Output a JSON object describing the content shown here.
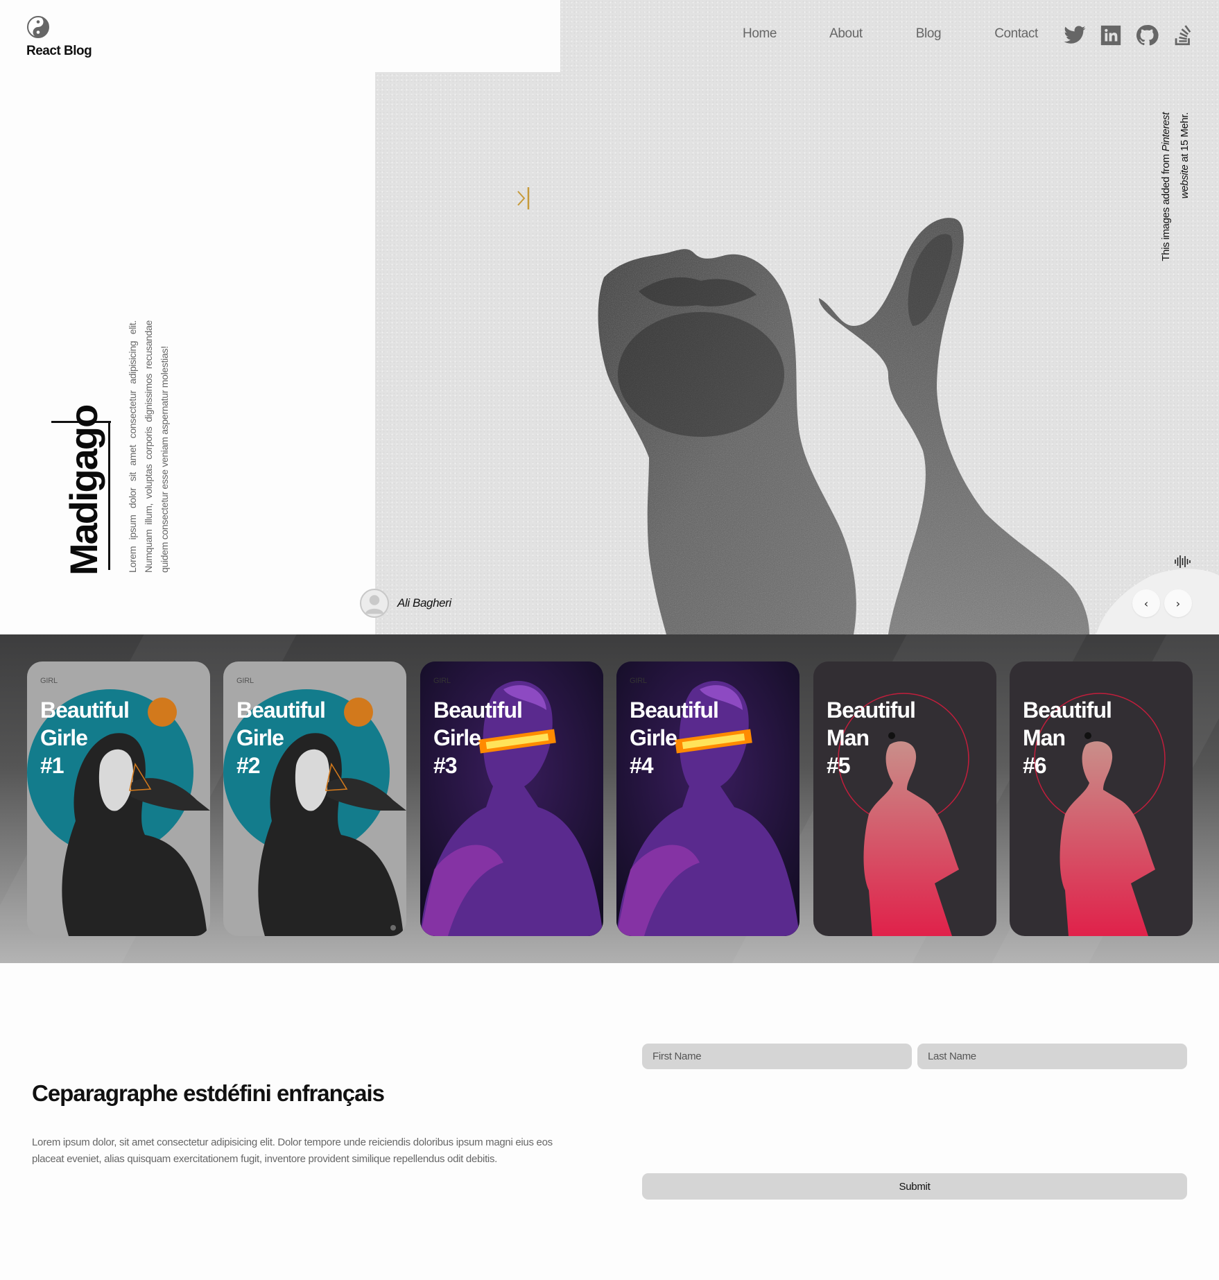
{
  "brand": {
    "title": "React Blog",
    "logo_icon": "yin-yang-icon"
  },
  "nav": {
    "items": [
      "Home",
      "About",
      "Blog",
      "Contact"
    ]
  },
  "socials": [
    "twitter-icon",
    "linkedin-icon",
    "github-icon",
    "stackoverflow-icon"
  ],
  "hero": {
    "title": "Madigago",
    "lorem": "Lorem ipsum dolor sit amet consectetur adipisicing elit. Numquam illum, voluptas corporis dignissimos recusandae quidem consectetur esse veniam aspernatur molestias!",
    "credit_prefix": "This images added from ",
    "credit_source": "Pinterest website",
    "credit_suffix": " at 15 Mehr.",
    "author": "Ali Bagheri",
    "prev_label": "‹",
    "next_label": "›",
    "accent": "#c69a3a"
  },
  "cards": [
    {
      "tag": "GIRL",
      "line1": "Beautiful",
      "line2": "Girle",
      "line3": "#1"
    },
    {
      "tag": "GIRL",
      "line1": "Beautiful",
      "line2": "Girle",
      "line3": "#2"
    },
    {
      "tag": "GIRL",
      "line1": "Beautiful",
      "line2": "Girle",
      "line3": "#3"
    },
    {
      "tag": "GIRL",
      "line1": "Beautiful",
      "line2": "Girle",
      "line3": "#4"
    },
    {
      "tag": "",
      "line1": "Beautiful",
      "line2": "Man",
      "line3": "#5"
    },
    {
      "tag": "",
      "line1": "Beautiful",
      "line2": "Man",
      "line3": "#6"
    }
  ],
  "contact": {
    "title": "Ceparagraphe estdéfini enfrançais",
    "text": "Lorem ipsum dolor, sit amet consectetur adipisicing elit. Dolor tempore unde reiciendis doloribus ipsum magni eius eos placeat eveniet, alias quisquam exercitationem fugit, inventore provident similique repellendus odit debitis.",
    "first_name_placeholder": "First Name",
    "last_name_placeholder": "Last Name",
    "submit_label": "Submit"
  },
  "colors": {
    "teal": "#137c8c",
    "orange": "#d2791c",
    "purple": "#5a2a8e",
    "laser": "#ffb21a",
    "crimson": "#d6264a",
    "card_gray": "#a8a8a8",
    "card_dark": "#322e33"
  }
}
